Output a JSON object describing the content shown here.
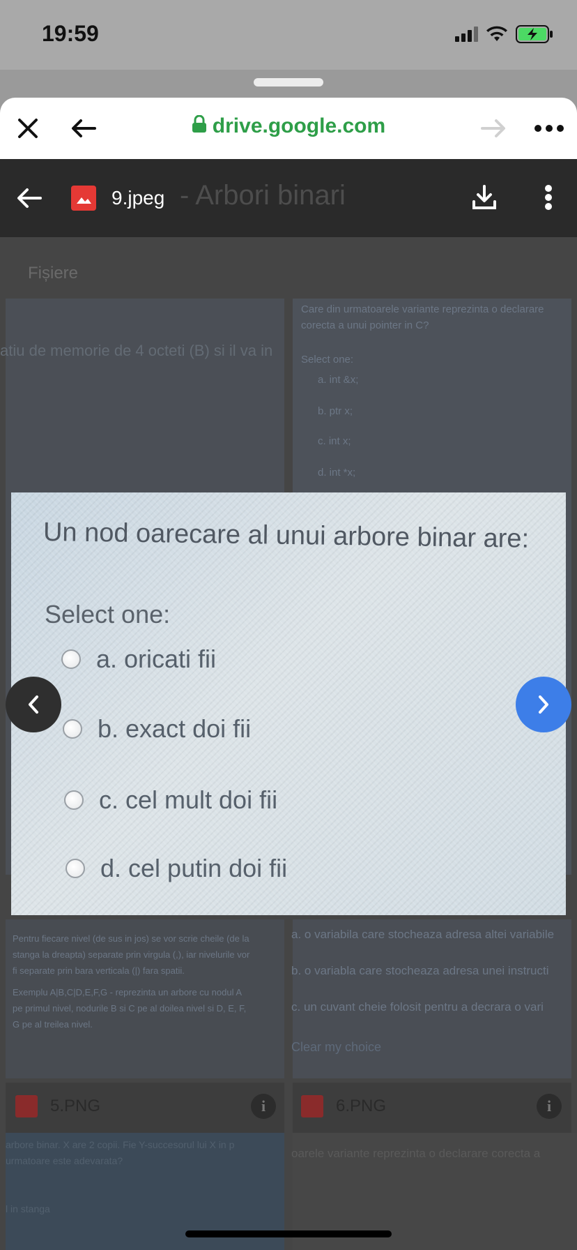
{
  "status": {
    "time": "19:59"
  },
  "browser": {
    "url": "drive.google.com"
  },
  "viewer": {
    "file_name": "9.jpeg",
    "background_title": "- Arbori binari"
  },
  "background": {
    "files_label": "Fișiere",
    "left_snippet": "atiu de memorie de 4 octeti (B) si il va in",
    "right_question": "Care din urmatoarele variante reprezinta o declarare corecta a unui pointer in C?",
    "right_select": "Select one:",
    "right_options": [
      "a. int &x;",
      "b. ptr x;",
      "c. int x;",
      "d. int *x;"
    ],
    "lower_left_lines": [
      "Pentru fiecare nivel (de sus in jos) se vor scrie cheile (de la",
      "stanga la dreapta) separate prin virgula (,), iar nivelurile vor",
      "fi separate prin bara verticala (|) fara spatii.",
      "Exemplu A|B,C|D,E,F,G - reprezinta un arbore cu nodul A",
      "pe primul nivel, nodurile B si C pe al doilea nivel si D, E, F,",
      "G pe al treilea nivel."
    ],
    "lower_right_lines": [
      "a. o variabila care stocheaza adresa altei variabile",
      "b. o variabla care stocheaza adresa unei instructi",
      "c. un cuvant cheie folosit pentru a decrara o vari"
    ],
    "clear_choice": "Clear my choice",
    "thumb1_label": "5.PNG",
    "thumb2_label": "6.PNG",
    "bottom_left_lines": [
      "arbore binar. X are 2 copii. Fie Y-succesorul lui X in p",
      "urmatoare este adevarata?"
    ],
    "bottom_left_extra": "l in stanga",
    "bottom_right_line": "oarele variante reprezinta o declarare corecta a"
  },
  "photo": {
    "question": "Un nod oarecare al unui arbore binar are:",
    "select_label": "Select one:",
    "options": [
      "a. oricati fii",
      "b. exact doi fii",
      "c. cel mult doi fii",
      "d. cel putin doi fii"
    ]
  },
  "colors": {
    "url_green": "#2e9e48",
    "next_blue": "#3d7ee8",
    "file_icon_red": "#e53935"
  },
  "icons": [
    "close-icon",
    "back-arrow-icon",
    "forward-arrow-icon",
    "more-icon",
    "lock-icon",
    "image-file-icon",
    "download-icon",
    "more-vertical-icon",
    "chevron-left-icon",
    "chevron-right-icon",
    "info-icon"
  ]
}
